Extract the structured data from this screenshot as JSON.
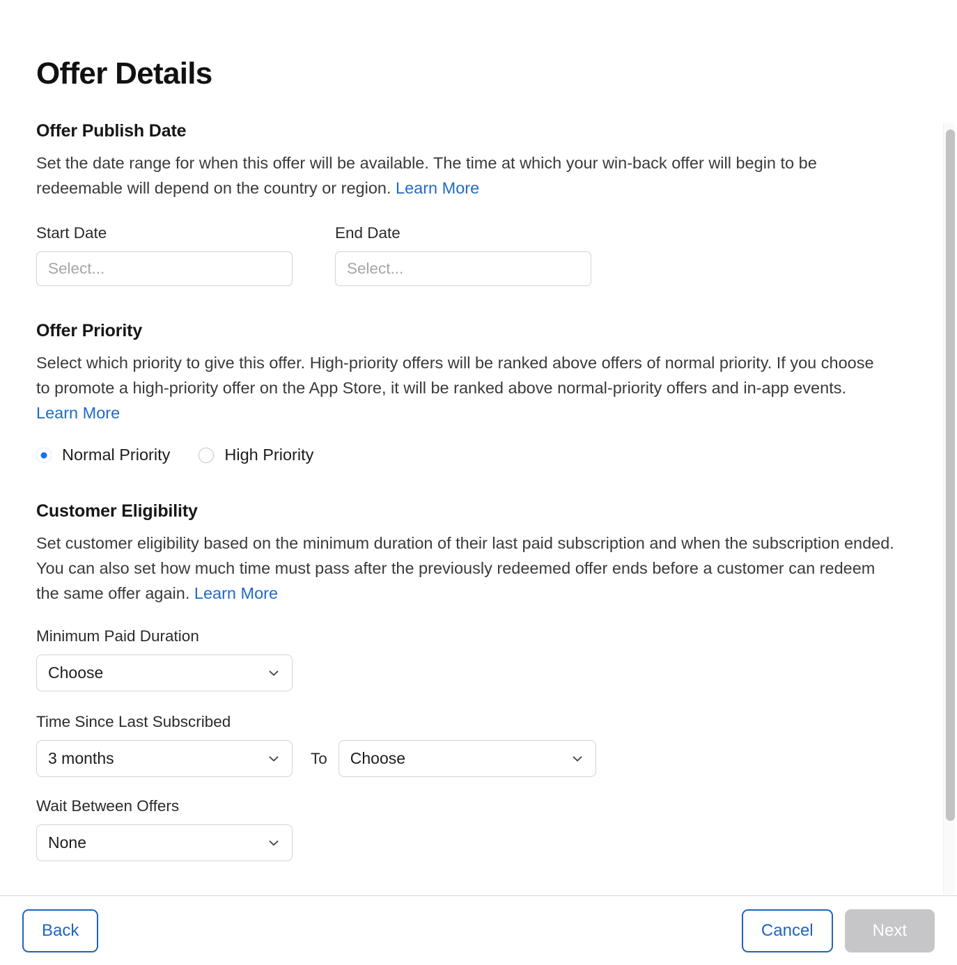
{
  "page": {
    "title": "Offer Details"
  },
  "sections": {
    "publish_date": {
      "heading": "Offer Publish Date",
      "description": "Set the date range for when this offer will be available. The time at which your win-back offer will begin to be redeemable will depend on the country or region. ",
      "learn_more": "Learn More",
      "start_date": {
        "label": "Start Date",
        "value": "",
        "placeholder": "Select..."
      },
      "end_date": {
        "label": "End Date",
        "value": "",
        "placeholder": "Select..."
      }
    },
    "offer_priority": {
      "heading": "Offer Priority",
      "description": "Select which priority to give this offer. High-priority offers will be ranked above offers of normal priority. If you choose to promote a high-priority offer on the App Store, it will be ranked above normal-priority offers and in-app events. ",
      "learn_more": "Learn More",
      "options": [
        {
          "label": "Normal Priority",
          "selected": true
        },
        {
          "label": "High Priority",
          "selected": false
        }
      ]
    },
    "customer_eligibility": {
      "heading": "Customer Eligibility",
      "description": "Set customer eligibility based on the minimum duration of their last paid subscription and when the subscription ended. You can also set how much time must pass after the previously redeemed offer ends before a customer can redeem the same offer again. ",
      "learn_more": "Learn More",
      "minimum_paid_duration": {
        "label": "Minimum Paid Duration",
        "value": "Choose"
      },
      "time_since_last_subscribed": {
        "label": "Time Since Last Subscribed",
        "from_value": "3 months",
        "separator": "To",
        "to_value": "Choose"
      },
      "wait_between_offers": {
        "label": "Wait Between Offers",
        "value": "None"
      }
    }
  },
  "footer": {
    "back_label": "Back",
    "cancel_label": "Cancel",
    "next_label": "Next"
  },
  "colors": {
    "link": "#216bc6",
    "radio_selected": "#1273ee",
    "button_outline": "#1f64bd",
    "next_disabled_bg": "#c6c6c8",
    "scroll_thumb": "#c2c2c2"
  },
  "icons": {
    "chevron_down": "chevron-down-icon"
  }
}
